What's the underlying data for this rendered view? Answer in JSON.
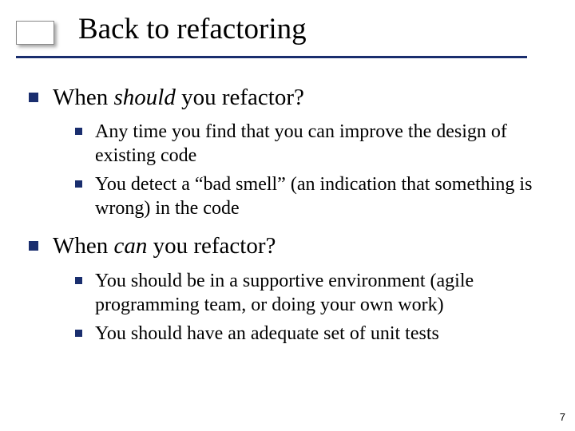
{
  "title": "Back to refactoring",
  "sections": [
    {
      "heading_pre": "When ",
      "heading_em": "should",
      "heading_post": " you refactor?",
      "items": [
        "Any time you find that you can improve the design of existing code",
        "You detect a “bad smell” (an indication that something is wrong) in the code"
      ]
    },
    {
      "heading_pre": "When ",
      "heading_em": "can",
      "heading_post": " you refactor?",
      "items": [
        "You should be in a supportive environment (agile programming team, or doing your own work)",
        "You should have an adequate set of unit tests"
      ]
    }
  ],
  "page_number": "7"
}
